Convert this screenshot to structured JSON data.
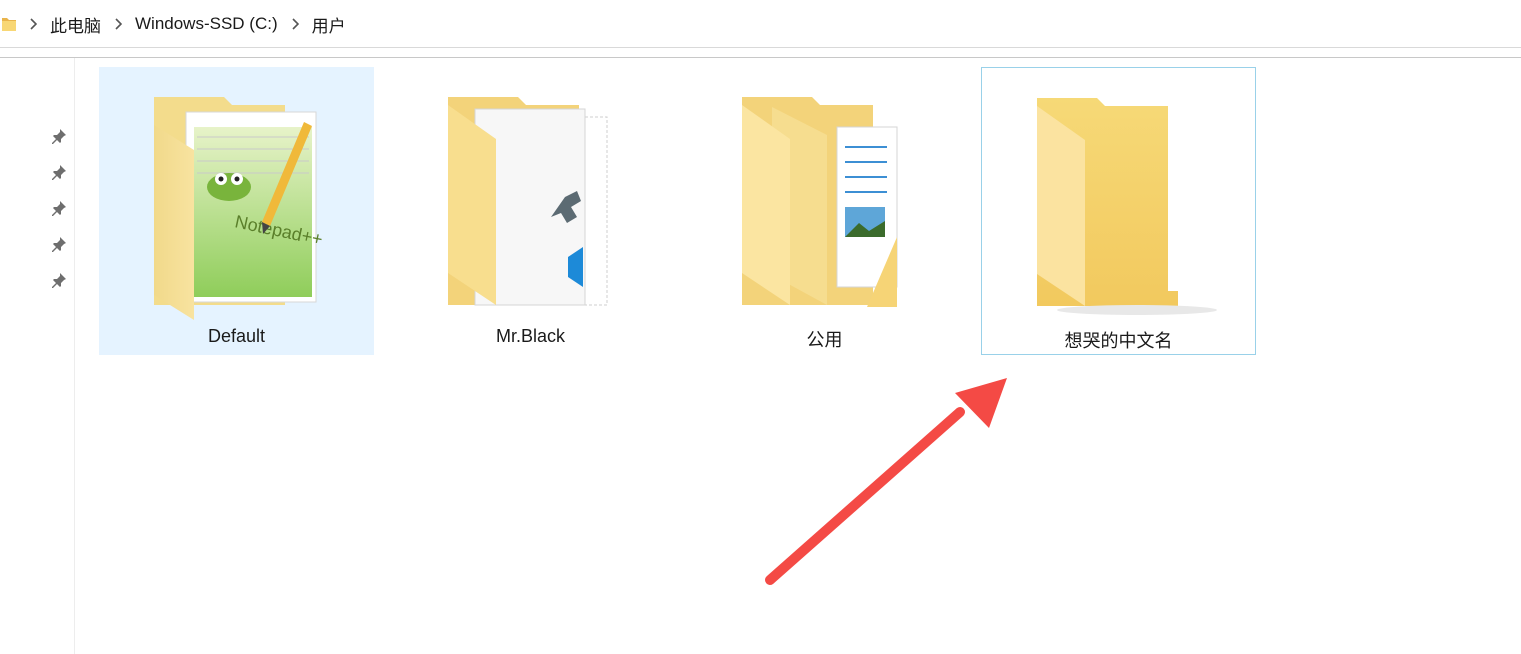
{
  "address_bar": {
    "crumbs": [
      "此电脑",
      "Windows-SSD (C:)",
      "用户"
    ]
  },
  "folders": [
    {
      "name": "Default",
      "icon": "notepad-folder-icon",
      "selected": true
    },
    {
      "name": "Mr.Black",
      "icon": "documents-folder-icon",
      "selected": false
    },
    {
      "name": "公用",
      "icon": "public-folder-icon",
      "selected": false
    },
    {
      "name": "想哭的中文名",
      "icon": "empty-folder-icon",
      "selected": false,
      "focused": true
    }
  ],
  "colors": {
    "folder_yellow": "#f8d775",
    "selection_bg": "#e5f3ff",
    "focus_border": "#99d1e9",
    "annotation_arrow": "#f44a45"
  }
}
